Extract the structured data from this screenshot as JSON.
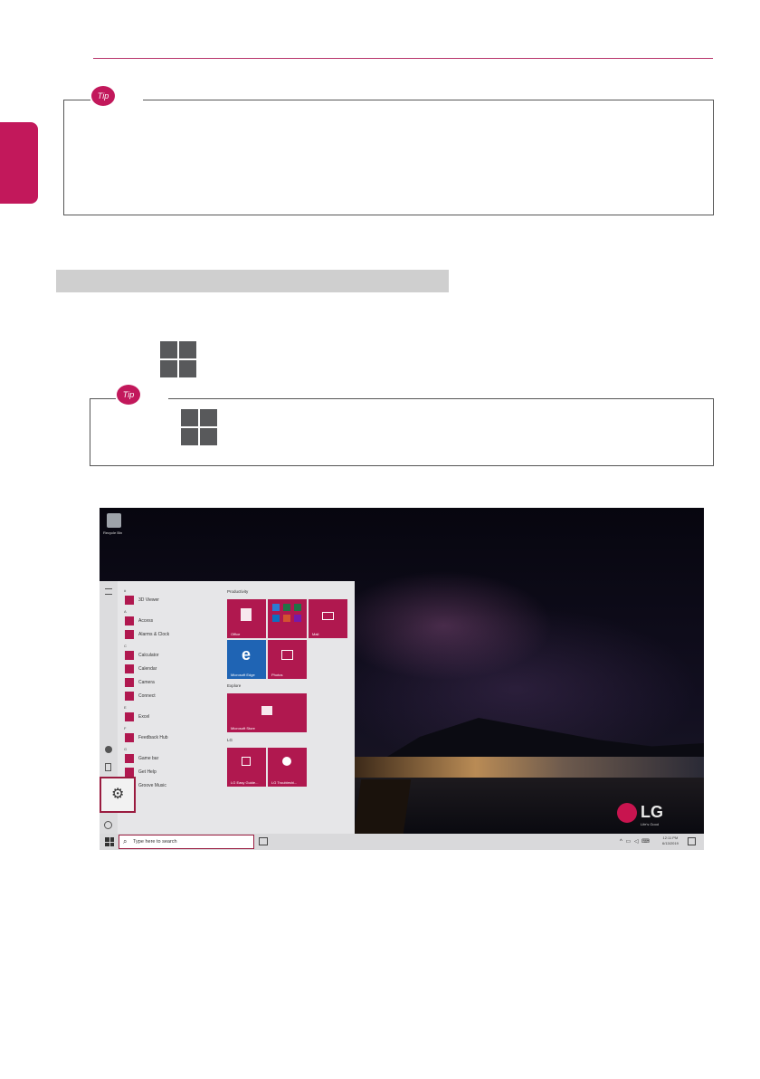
{
  "tips": {
    "tip1_badge": "Tip",
    "tip2_badge": "Tip"
  },
  "screenshot": {
    "recycle_bin": "Recycle Bin",
    "app_list": [
      {
        "type": "head",
        "text": "#"
      },
      {
        "type": "app",
        "text": "3D Viewer"
      },
      {
        "type": "head",
        "text": "A"
      },
      {
        "type": "app",
        "text": "Access"
      },
      {
        "type": "app",
        "text": "Alarms & Clock"
      },
      {
        "type": "head",
        "text": "C"
      },
      {
        "type": "app",
        "text": "Calculator"
      },
      {
        "type": "app",
        "text": "Calendar"
      },
      {
        "type": "app",
        "text": "Camera"
      },
      {
        "type": "app",
        "text": "Connect"
      },
      {
        "type": "head",
        "text": "E"
      },
      {
        "type": "app",
        "text": "Excel"
      },
      {
        "type": "head",
        "text": "F"
      },
      {
        "type": "app",
        "text": "Feedback Hub"
      },
      {
        "type": "head",
        "text": "G"
      },
      {
        "type": "app",
        "text": "Game bar"
      },
      {
        "type": "app",
        "text": "Get Help"
      },
      {
        "type": "app",
        "text": "Groove Music"
      }
    ],
    "groups": {
      "productivity": "Productivity",
      "explore": "Explore",
      "lg": "LG"
    },
    "tiles": {
      "office": "Office",
      "mail": "Mail",
      "edge": "Microsoft Edge",
      "photos": "Photos",
      "store": "Microsoft Store",
      "lg_easy": "LG Easy Guide...",
      "lg_trouble": "LG Troubleshi..."
    },
    "search_placeholder": "Type here to search",
    "clock_time": "12:11 PM",
    "clock_date": "6/13/2019",
    "brand": "LG",
    "brand_tagline": "Life's Good"
  },
  "icons": {
    "windows_logo": "windows-logo-icon",
    "settings": "gear-icon",
    "search": "search-icon"
  },
  "colors": {
    "accent": "#c2185b",
    "highlight_border": "#9a1b3f",
    "tile": "#b0184f"
  }
}
